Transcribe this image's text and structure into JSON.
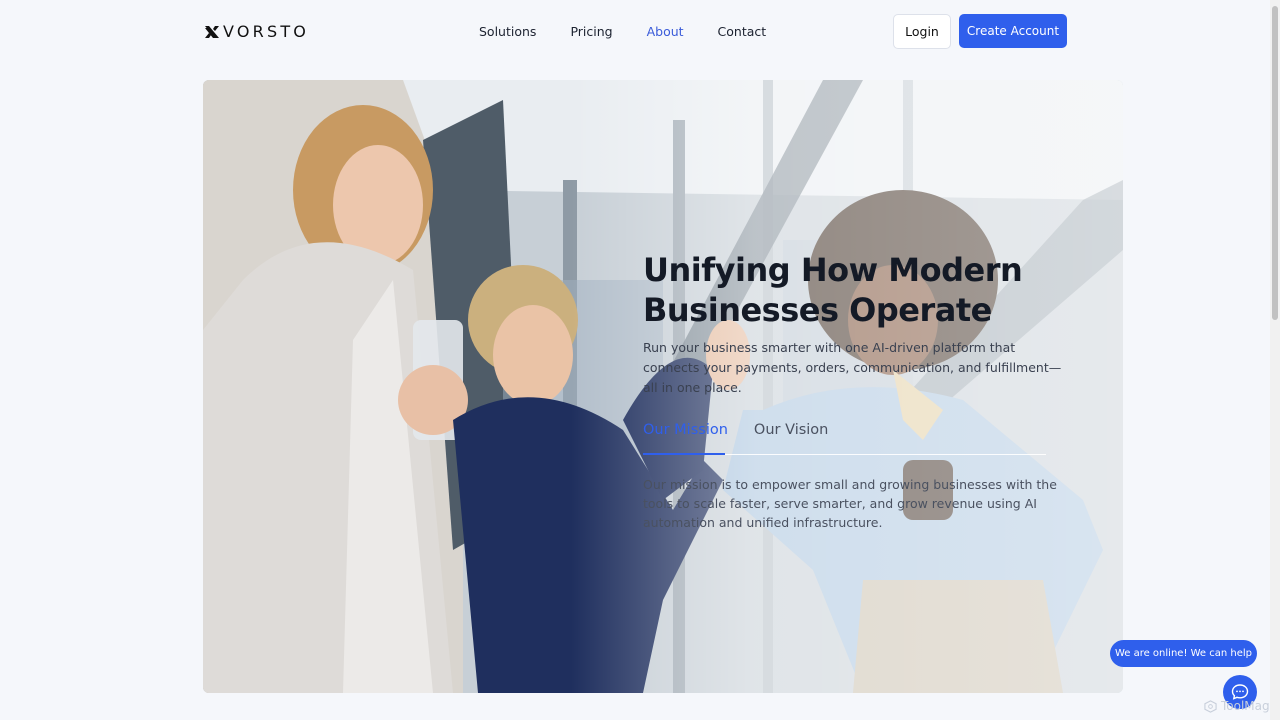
{
  "brand": {
    "name": "VORSTO"
  },
  "nav": {
    "items": [
      {
        "label": "Solutions",
        "active": false
      },
      {
        "label": "Pricing",
        "active": false
      },
      {
        "label": "About",
        "active": true
      },
      {
        "label": "Contact",
        "active": false
      }
    ]
  },
  "header": {
    "login_label": "Login",
    "create_account_label": "Create Account"
  },
  "hero": {
    "title_line1": "Unifying How Modern",
    "title_line2": "Businesses Operate",
    "description": "Run your business smarter with one AI-driven platform that connects your payments, orders, communication, and fulfillment—all in one place.",
    "tabs": [
      {
        "label": "Our Mission",
        "active": true
      },
      {
        "label": "Our Vision",
        "active": false
      }
    ],
    "tab_body": "Our mission is to empower small and growing businesses with the tools to scale faster, serve smarter, and grow revenue using AI automation and unified infrastructure."
  },
  "chat": {
    "bubble_text": "We are online! We can help",
    "icon": "chat-icon"
  },
  "watermark": {
    "text": "ToolMage"
  },
  "colors": {
    "accent": "#2f5fec",
    "nav_active": "#3a5bd9",
    "background": "#f5f7fb"
  }
}
